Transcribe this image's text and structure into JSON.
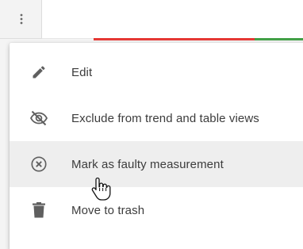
{
  "colors": {
    "trend_red": "#e53935",
    "trend_green": "#43a047",
    "icon_gray": "#5f5f5f",
    "highlight_bg": "#eeeeee"
  },
  "header": {
    "kebab_icon": "vertical-dots-icon"
  },
  "menu": {
    "items": [
      {
        "label": "Edit",
        "icon": "pencil-icon"
      },
      {
        "label": "Exclude from trend and table views",
        "icon": "eye-off-icon"
      },
      {
        "label": "Mark as faulty measurement",
        "icon": "circle-x-icon",
        "highlighted": true
      },
      {
        "label": "Move to trash",
        "icon": "trash-icon"
      }
    ]
  }
}
